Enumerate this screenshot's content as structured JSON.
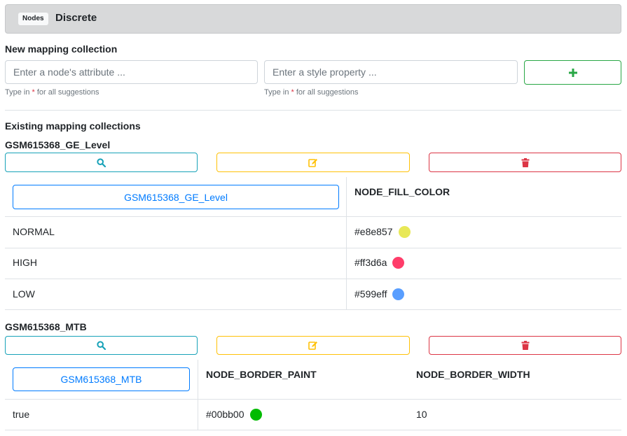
{
  "header": {
    "badge": "Nodes",
    "title": "Discrete"
  },
  "new_collection": {
    "label": "New mapping collection",
    "attribute_placeholder": "Enter a node's attribute ...",
    "style_placeholder": "Enter a style property ...",
    "help_prefix": "Type in",
    "help_star": "*",
    "help_suffix": "for all suggestions",
    "add_icon": "plus-icon"
  },
  "existing": {
    "label": "Existing mapping collections",
    "collections": [
      {
        "name": "GSM615368_GE_Level",
        "attribute_button": "GSM615368_GE_Level",
        "columns": [
          "NODE_FILL_COLOR"
        ],
        "rows": [
          {
            "key": "NORMAL",
            "values": [
              "#e8e857"
            ],
            "colors": [
              "#e8e857"
            ]
          },
          {
            "key": "HIGH",
            "values": [
              "#ff3d6a"
            ],
            "colors": [
              "#ff3d6a"
            ]
          },
          {
            "key": "LOW",
            "values": [
              "#599eff"
            ],
            "colors": [
              "#599eff"
            ]
          }
        ]
      },
      {
        "name": "GSM615368_MTB",
        "attribute_button": "GSM615368_MTB",
        "columns": [
          "NODE_BORDER_PAINT",
          "NODE_BORDER_WIDTH"
        ],
        "rows": [
          {
            "key": "true",
            "values": [
              "#00bb00",
              "10"
            ],
            "colors": [
              "#00bb00",
              null
            ]
          }
        ]
      }
    ]
  },
  "icons": {
    "search": "search-icon",
    "edit": "edit-icon",
    "delete": "trash-icon"
  },
  "colors": {
    "success": "#28a745",
    "info": "#17a2b8",
    "warning": "#ffc107",
    "danger": "#dc3545",
    "primary": "#007bff"
  }
}
